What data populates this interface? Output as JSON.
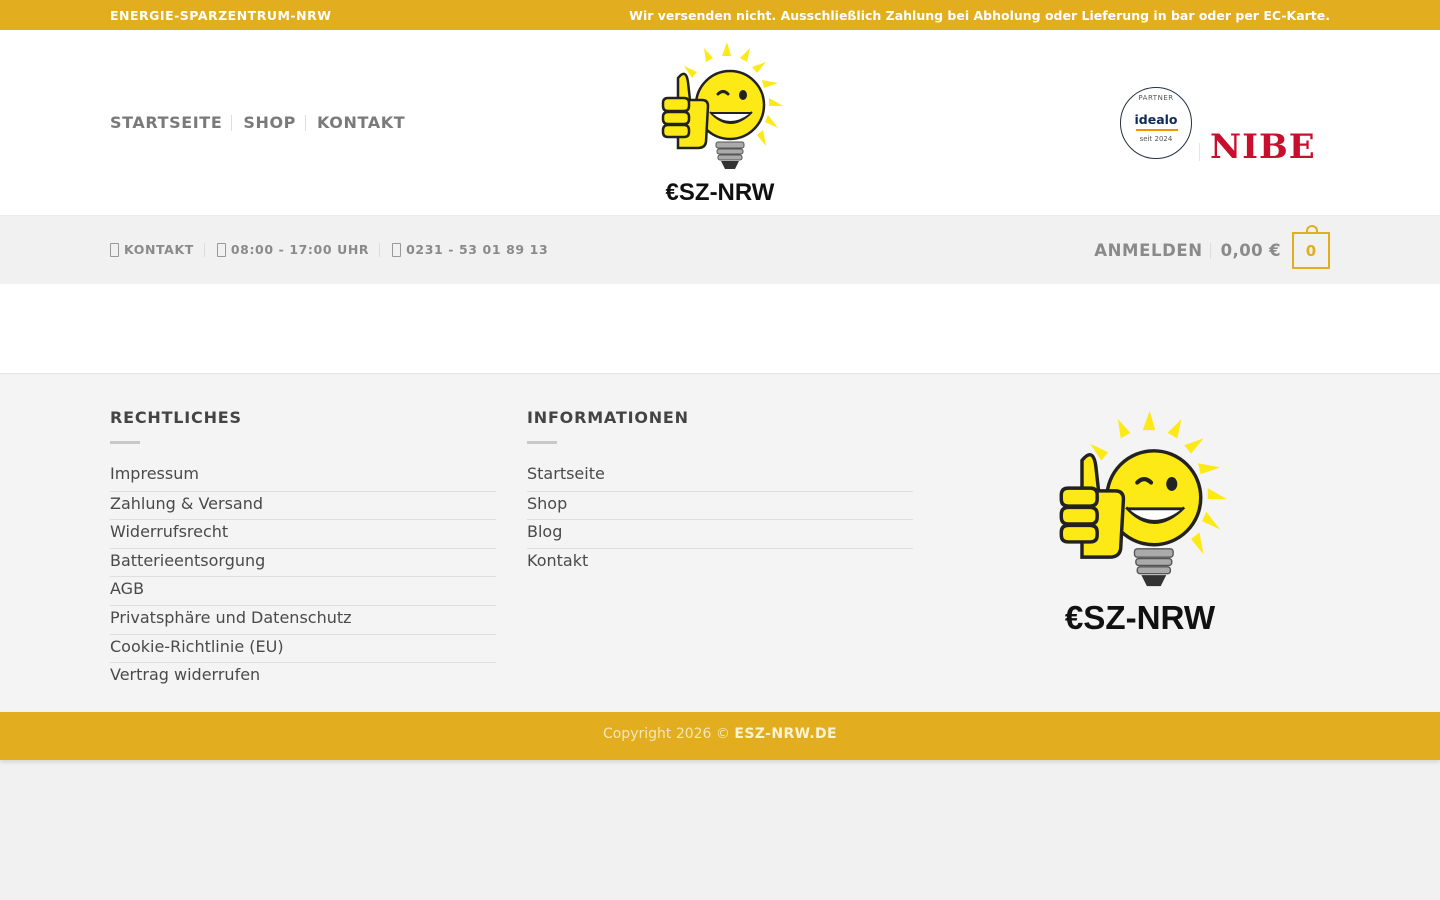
{
  "topbar": {
    "left_text": "ENERGIE-SPARZENTRUM-NRW",
    "right_text": "Wir versenden nicht. Ausschließlich Zahlung bei Abholung oder Lieferung in bar oder per EC-Karte."
  },
  "header": {
    "nav": [
      {
        "label": "STARTSEITE"
      },
      {
        "label": "SHOP"
      },
      {
        "label": "KONTAKT"
      }
    ],
    "logo_text": "€SZ-NRW",
    "partner_badge": {
      "top": "PARTNER",
      "brand": "idealo",
      "bottom": "seit 2024"
    },
    "nibe_logo": "NIBE"
  },
  "secondary_bar": {
    "items": [
      {
        "label": "KONTAKT",
        "icon": "envelope-icon"
      },
      {
        "label": "08:00 - 17:00 UHR",
        "icon": "clock-icon"
      },
      {
        "label": "0231 - 53 01 89 13",
        "icon": "phone-icon"
      }
    ],
    "login_label": "ANMELDEN",
    "cart_total": "0,00 €",
    "cart_count": "0"
  },
  "footer": {
    "legal": {
      "title": "RECHTLICHES",
      "links": [
        "Impressum",
        "Zahlung & Versand",
        "Widerrufsrecht",
        "Batterieentsorgung",
        "AGB",
        "Privatsphäre und Datenschutz",
        "Cookie-Richtlinie (EU)",
        "Vertrag widerrufen"
      ]
    },
    "info": {
      "title": "INFORMATIONEN",
      "links": [
        "Startseite",
        "Shop",
        "Blog",
        "Kontakt"
      ]
    },
    "logo_text": "€SZ-NRW"
  },
  "copyright": {
    "prefix": "Copyright 2026 ©",
    "site": "ESZ-NRW.DE"
  },
  "colors": {
    "accent": "#e2ad1e",
    "nibe_red": "#c8102e",
    "sun_yellow": "#fde915"
  }
}
